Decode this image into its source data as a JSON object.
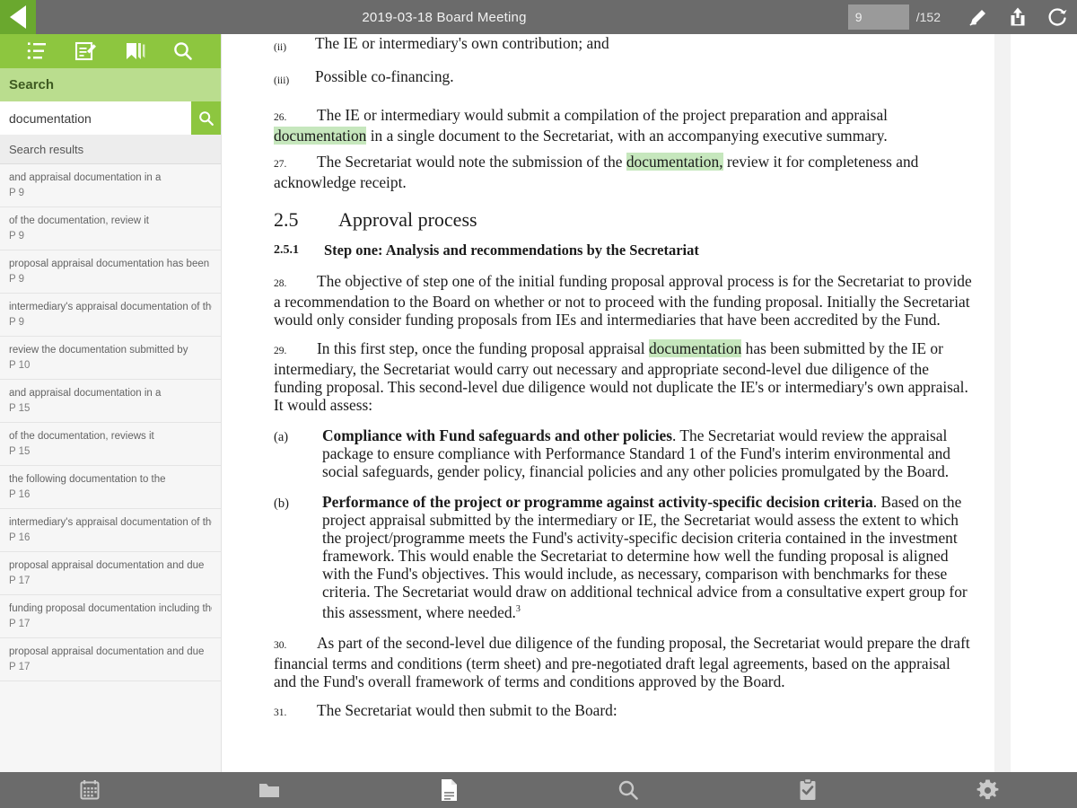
{
  "topbar": {
    "back_icon": "back-arrow-icon",
    "title": "2019-03-18 Board Meeting",
    "page_number": "9",
    "page_total": "/152",
    "icons": [
      "pencil-edit-icon",
      "share-upload-icon",
      "refresh-sync-icon"
    ]
  },
  "sidebar": {
    "tabs": [
      {
        "name": "outline-tab",
        "icon": "list-outline-icon"
      },
      {
        "name": "annotations-tab",
        "icon": "edit-note-icon"
      },
      {
        "name": "bookmarks-tab",
        "icon": "bookmark-icon"
      },
      {
        "name": "search-tab",
        "icon": "search-icon"
      }
    ],
    "panel_title": "Search",
    "search_value": "documentation",
    "search_placeholder": "Search",
    "search_button_icon": "search-icon",
    "results_label": "Search results",
    "results": [
      {
        "snippet": "and appraisal documentation in a",
        "page": "P 9"
      },
      {
        "snippet": "of the documentation, review it",
        "page": "P 9"
      },
      {
        "snippet": "proposal appraisal documentation has been",
        "page": "P 9"
      },
      {
        "snippet": "intermediary's appraisal documentation of the",
        "page": "P 9"
      },
      {
        "snippet": "review the documentation submitted by",
        "page": "P 10"
      },
      {
        "snippet": "and appraisal documentation in a",
        "page": "P 15"
      },
      {
        "snippet": "of the documentation, reviews it",
        "page": "P 15"
      },
      {
        "snippet": "the following documentation to the",
        "page": "P 16"
      },
      {
        "snippet": "intermediary's appraisal documentation of the",
        "page": "P 16"
      },
      {
        "snippet": "proposal appraisal documentation and due",
        "page": "P 17"
      },
      {
        "snippet": "funding proposal documentation including the",
        "page": "P 17"
      },
      {
        "snippet": "proposal appraisal documentation and due",
        "page": "P 17"
      }
    ]
  },
  "document": {
    "roman_items": [
      {
        "num": "(ii)",
        "text": "The IE or intermediary's own contribution; and"
      },
      {
        "num": "(iii)",
        "text": "Possible co-financing."
      }
    ],
    "para26_num": "26.",
    "para26_a": "The IE or intermediary would submit a compilation of the project preparation and appraisal ",
    "para26_hl": "documentation",
    "para26_b": " in a single document to the Secretariat, with an accompanying executive summary.",
    "para27_num": "27.",
    "para27_a": "The Secretariat would note the submission of the ",
    "para27_hl": "documentation,",
    "para27_b": " review it for completeness and acknowledge receipt.",
    "heading_num": "2.5",
    "heading_text": "Approval process",
    "sub_num": "2.5.1",
    "sub_text": "Step one:  Analysis and recommendations by the Secretariat",
    "para28_num": "28.",
    "para28_text": "The objective of step one of the initial funding proposal approval process is for the Secretariat to provide a recommendation to the Board on whether or not to proceed with the funding proposal. Initially the Secretariat would only consider funding proposals from IEs and intermediaries that have been accredited by the Fund.",
    "para29_num": "29.",
    "para29_a": "In this first step, once the funding proposal appraisal ",
    "para29_hl": "documentation",
    "para29_b": " has been submitted by the IE or intermediary, the Secretariat would carry out necessary and appropriate second-level due diligence of the funding proposal. This second-level due diligence would not duplicate the IE's or intermediary's own appraisal. It would assess:",
    "item_a_letter": "(a)",
    "item_a_bold": "Compliance with Fund safeguards and other policies",
    "item_a_text": ".  The Secretariat would review the appraisal package to ensure compliance with Performance Standard 1 of the Fund's interim environmental and social safeguards, gender policy, financial policies and any other policies promulgated by the Board.",
    "item_b_letter": "(b)",
    "item_b_bold": "Performance of the project or programme against activity-specific decision criteria",
    "item_b_text": ".  Based on the project appraisal submitted by the intermediary or IE, the Secretariat would assess the extent to which the project/programme meets the Fund's activity-specific decision criteria contained in the investment framework. This would enable the Secretariat to determine how well the funding proposal is aligned with the Fund's objectives. This would include, as necessary, comparison with benchmarks for these criteria. The Secretariat would draw on additional technical advice from a consultative expert group for this assessment, where needed.",
    "item_b_footnote": "3",
    "para30_num": "30.",
    "para30_text": "As part of the second-level due diligence of the funding proposal, the Secretariat would prepare the draft financial terms and conditions (term sheet) and pre-negotiated draft legal agreements, based on the appraisal and the Fund's overall framework of terms and conditions approved by the Board.",
    "para31_num": "31.",
    "para31_text": "The Secretariat would then submit to the Board:"
  },
  "bottombar": {
    "items": [
      {
        "name": "calendar-button",
        "icon": "calendar-icon"
      },
      {
        "name": "folder-button",
        "icon": "folder-icon"
      },
      {
        "name": "documents-button",
        "icon": "document-icon"
      },
      {
        "name": "search-button",
        "icon": "search-icon"
      },
      {
        "name": "tasks-button",
        "icon": "clipboard-check-icon"
      },
      {
        "name": "settings-button",
        "icon": "gear-icon"
      }
    ]
  },
  "colors": {
    "brand_green": "#8dc63f",
    "brand_green_dark": "#6aa82e",
    "panel_green": "#badd8e",
    "bar_gray": "#6b6b6b",
    "highlight": "#c6e7bd"
  }
}
